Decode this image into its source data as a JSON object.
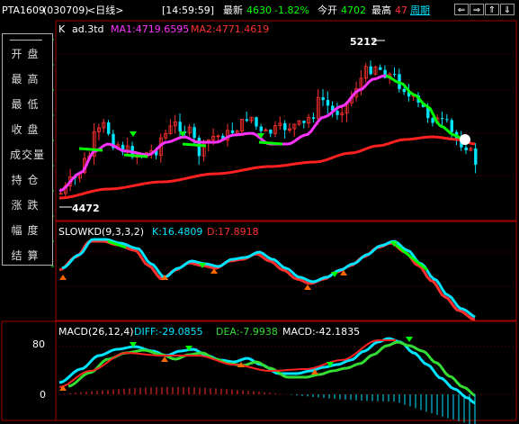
{
  "header": {
    "symbol": "PTA1609",
    "code": "(030709)",
    "period": "<日线>",
    "time": "[14:59:59]",
    "latest_label": "最新",
    "latest_value": "4630",
    "change_pct": "-1.82%",
    "open_label": "今开",
    "open_value": "4702",
    "high_label": "最高",
    "high_value": "47",
    "cycle_button": "周期"
  },
  "nav_buttons": [
    "left-arrow",
    "right-arrow",
    "up-arrow",
    "down-arrow"
  ],
  "sidebar": {
    "items": [
      "开盘",
      "最高",
      "最低",
      "收盘",
      "成交量",
      "持仓",
      "涨跌",
      "幅度",
      "结算"
    ]
  },
  "main_panel": {
    "indicator": "K",
    "name": "ad.3td",
    "ma1_label": "MA1:4719.6595",
    "ma2_label": "MA2:4771.4619",
    "high_mark": "5212",
    "low_mark": "4472"
  },
  "kd_panel": {
    "title": "SLOWKD(9,3,3,2)",
    "k_label": "K:16.4809",
    "d_label": "D:17.8918"
  },
  "macd_panel": {
    "title": "MACD(26,12,4)",
    "diff_label": "DIFF:-29.0855",
    "dea_label": "DEA:-7.9938",
    "macd_label": "MACD:-42.1835",
    "y_ticks": [
      "80",
      "0"
    ]
  },
  "colors": {
    "background": "#000000",
    "up": "#00e5ff",
    "down": "#ff3030",
    "ma1": "#ff33ff",
    "ma2": "#ff2020",
    "k_line": "#00e5ff",
    "d_line": "#ff3030",
    "diff": "#00e5ff",
    "dea": "#33dd33",
    "accent": "#00ff00"
  }
}
